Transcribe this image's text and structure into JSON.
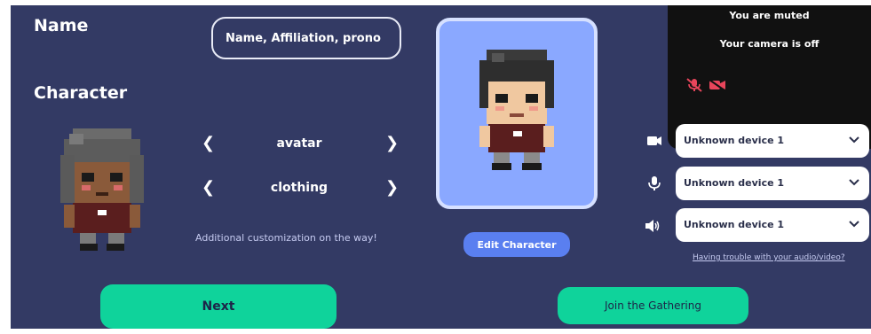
{
  "name_section": {
    "label": "Name",
    "placeholder": "Name, Affiliation, prono"
  },
  "character_section": {
    "label": "Character",
    "selectors": [
      {
        "label": "avatar",
        "prev_icon": "chevron-left-icon",
        "next_icon": "chevron-right-icon"
      },
      {
        "label": "clothing",
        "prev_icon": "chevron-left-icon",
        "next_icon": "chevron-right-icon"
      }
    ],
    "note": "Additional customization on the way!"
  },
  "preview": {
    "edit_label": "Edit Character"
  },
  "video": {
    "muted_text": "You are muted",
    "camera_text": "Your camera is off"
  },
  "devices": [
    {
      "icon": "camera-icon",
      "value": "Unknown device 1"
    },
    {
      "icon": "microphone-icon",
      "value": "Unknown device 1"
    },
    {
      "icon": "speaker-icon",
      "value": "Unknown device 1"
    }
  ],
  "trouble_link": "Having trouble with your audio/video?",
  "buttons": {
    "next": "Next",
    "join": "Join the Gathering"
  },
  "colors": {
    "background": "#333a64",
    "preview_bg": "#8aa8ff",
    "accent_green": "#0fd39b",
    "edit_blue": "#5a7ff0",
    "mute_red": "#e8455b"
  }
}
